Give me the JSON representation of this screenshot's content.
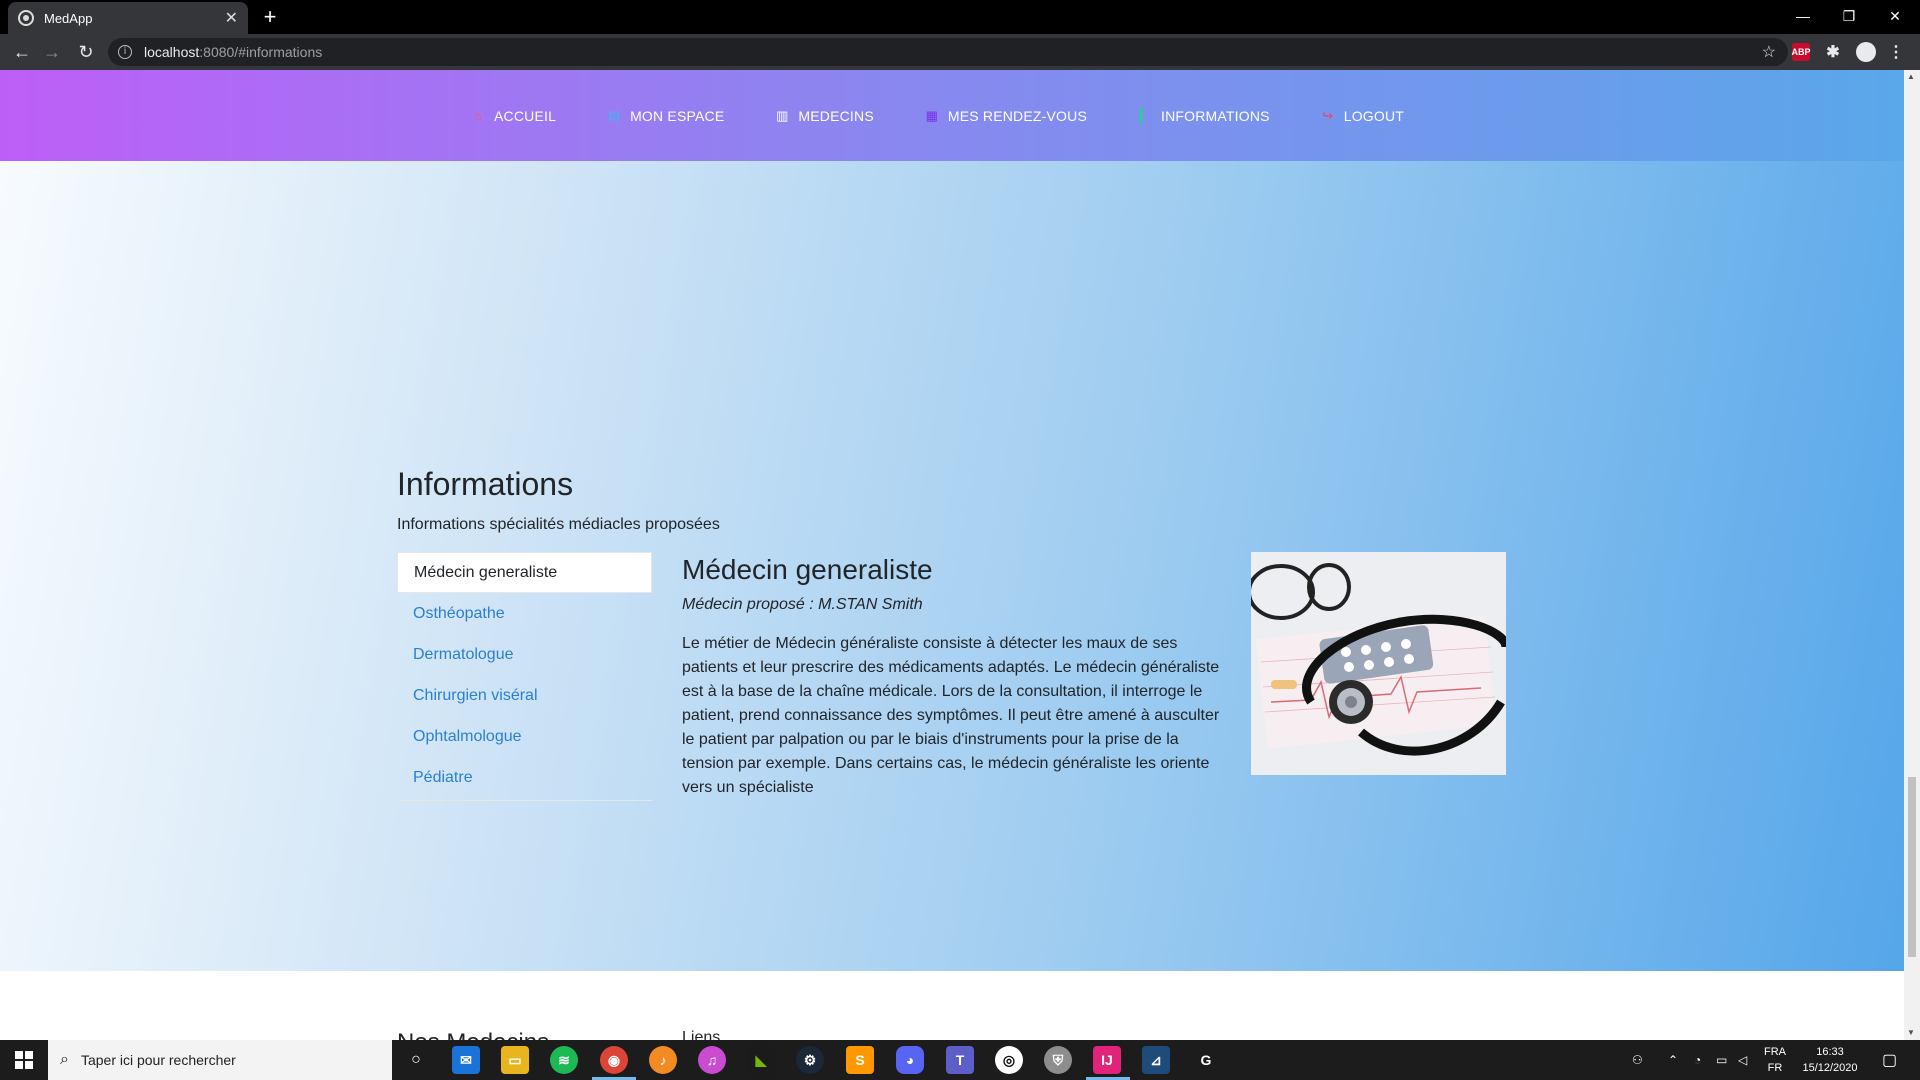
{
  "browser": {
    "tab_title": "MedApp",
    "url_host": "localhost",
    "url_path": ":8080/#informations"
  },
  "nav": {
    "items": [
      {
        "label": "ACCUEIL",
        "icon": "home-icon",
        "color": "#f2596f"
      },
      {
        "label": "MON ESPACE",
        "icon": "user-icon",
        "color": "#4ab1f1"
      },
      {
        "label": "MEDECINS",
        "icon": "hospital-icon",
        "color": "#ffffff"
      },
      {
        "label": "MES RENDEZ-VOUS",
        "icon": "calendar-icon",
        "color": "#7b2ff0"
      },
      {
        "label": "INFORMATIONS",
        "icon": "info-icon",
        "color": "#1fd88a"
      },
      {
        "label": "LOGOUT",
        "icon": "logout-icon",
        "color": "#ff3860"
      }
    ]
  },
  "page": {
    "title": "Informations",
    "subtitle": "Informations spécialités médiacles proposées"
  },
  "specialties": {
    "items": [
      "Médecin generaliste",
      "Osthéopathe",
      "Dermatologue",
      "Chirurgien viséral",
      "Ophtalmologue",
      "Pédiatre"
    ],
    "active_index": 0
  },
  "detail": {
    "title": "Médecin generaliste",
    "doctor": "Médecin proposé : M.STAN Smith",
    "text": "Le métier de Médecin généraliste consiste à détecter les maux de ses patients et leur prescrire des médicaments adaptés. Le médecin généraliste est à la base de la chaîne médicale. Lors de la consultation, il interroge le patient, prend connaissance des symptômes. Il peut être amené à ausculter le patient par palpation ou par le biais d'instruments pour la prise de la tension par exemple. Dans certains cas, le médecin généraliste les oriente vers un spécialiste",
    "image": "stethoscope-photo"
  },
  "footer": {
    "col1": "Nos Medecins",
    "col2": "Liens"
  },
  "taskbar": {
    "search_placeholder": "Taper ici pour rechercher",
    "lang_top": "FRA",
    "lang_bottom": "FR",
    "time": "16:33",
    "date": "15/12/2020"
  }
}
